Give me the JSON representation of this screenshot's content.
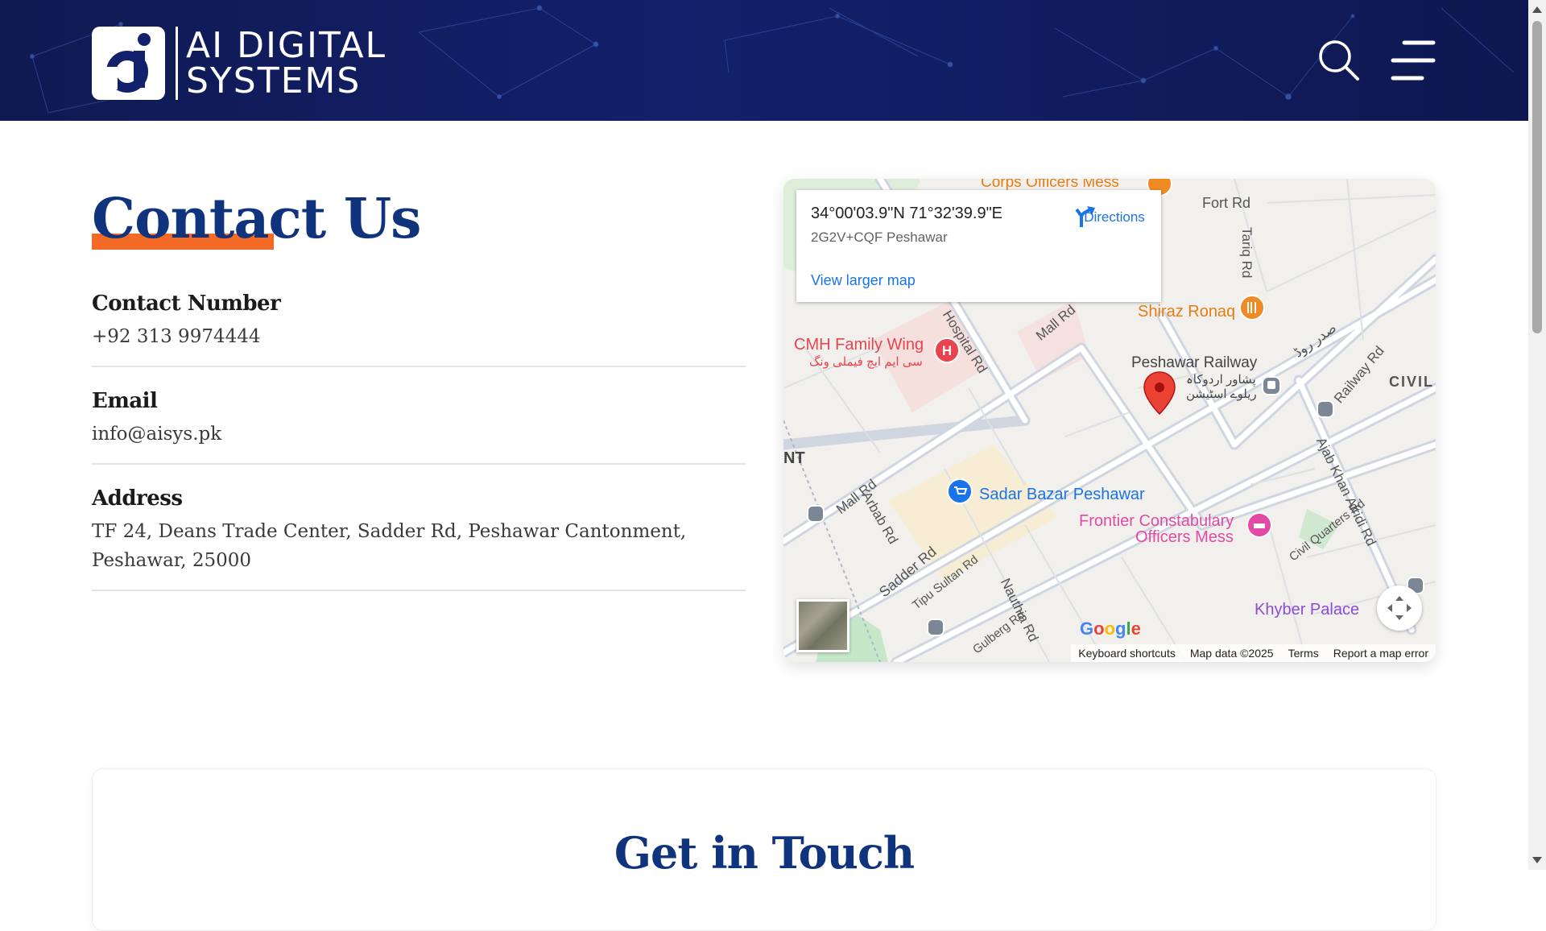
{
  "header": {
    "logo_line1": "AI DIGITAL",
    "logo_line2": "SYSTEMS",
    "search_icon": "search-icon",
    "menu_icon": "hamburger-menu-icon"
  },
  "contact": {
    "title": "Contact Us",
    "phone_label": "Contact Number",
    "phone_value": "+92 313 9974444",
    "email_label": "Email",
    "email_value": "info@aisys.pk",
    "address_label": "Address",
    "address_value": "TF 24, Deans Trade Center, Sadder Rd, Peshawar Cantonment, Peshawar, 25000"
  },
  "map": {
    "coords": "34°00'03.9\"N 71°32'39.9\"E",
    "plus_code": "2G2V+CQF Peshawar",
    "directions": "Directions",
    "view_larger": "View larger map",
    "footer": {
      "shortcuts": "Keyboard shortcuts",
      "map_data": "Map data ©2025",
      "terms": "Terms",
      "report": "Report a map error"
    },
    "places": {
      "corps": "Corps Officers Mess",
      "fort_rd": "Fort Rd",
      "tariq_rd": "Tariq Rd",
      "shiraz": "Shiraz Ronaq",
      "cmh": "CMH Family Wing",
      "cmh_urdu": "سی ایم ایچ فیملی ونگ",
      "hospital_rd": "Hospital Rd",
      "mall_rd_top": "Mall Rd",
      "railway_station": "Peshawar Railway",
      "railway_urdu1": "پشاور اردوکاہ",
      "railway_urdu2": "ریلوے اسٹیشن",
      "railway_rd": "Railway Rd",
      "saddar_urdu": "صدر روڈ",
      "civil": "CIVIL",
      "nt": "NT",
      "mall_rd": "Mall Rd",
      "arbab_rd": "Arbab Rd",
      "sadar_bazar": "Sadar Bazar Peshawar",
      "frontier1": "Frontier Constabulary",
      "frontier2": "Officers Mess",
      "civil_quarters": "Civil Quarters Rd",
      "ajab_khan": "Ajab Khan Afridi Rd",
      "sadder_rd": "Sadder Rd",
      "tipu_sultan": "Tipu Sultan Rd",
      "nauthia": "Nauthia Rd",
      "gulberg": "Gulberg Rd",
      "khyber": "Khyber Palace",
      "google": "Google"
    }
  },
  "touch": {
    "title": "Get in Touch"
  },
  "colors": {
    "header_bg": "#13206b",
    "title": "#10337e",
    "accent": "#f26a25",
    "map_link": "#1a73e8",
    "pin": "#ea4335"
  }
}
